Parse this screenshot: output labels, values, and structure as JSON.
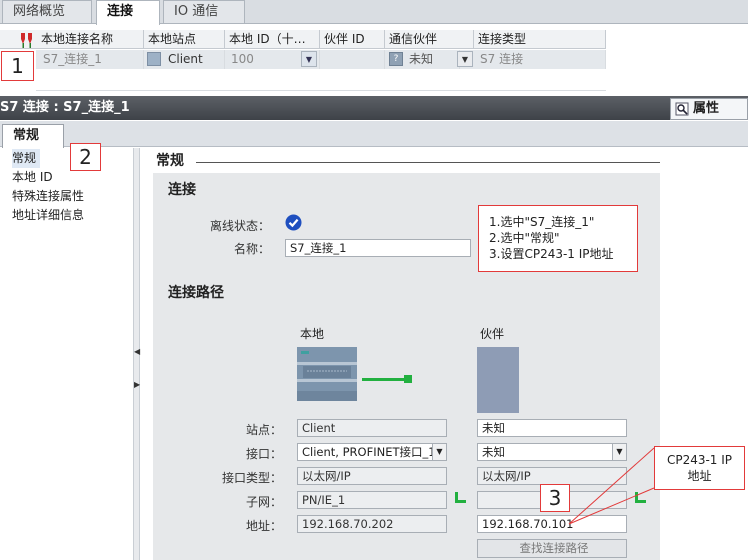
{
  "top_tabs": [
    "网络概览",
    "连接",
    "IO 通信"
  ],
  "table": {
    "headers": [
      "本地连接名称",
      "本地站点",
      "本地 ID（十…",
      "伙伴 ID",
      "通信伙伴",
      "连接类型"
    ],
    "row": {
      "name": "S7_连接_1",
      "station": "Client",
      "local_id": "100",
      "partner_id": "",
      "partner": "未知",
      "type": "S7 连接"
    }
  },
  "section_title": "S7 连接 : S7_连接_1",
  "properties_tab": "属性",
  "sub_tab": "常规",
  "nav_items": [
    "常规",
    "本地 ID",
    "特殊连接属性",
    "地址详细信息"
  ],
  "main": {
    "section_general": "常规",
    "group_connection": "连接",
    "offline_status_label": "离线状态：",
    "name_label": "名称：",
    "name_value": "S7_连接_1",
    "group_path": "连接路径",
    "local_header": "本地",
    "partner_header": "伙伴",
    "station_label": "站点：",
    "interface_label": "接口：",
    "interface_type_label": "接口类型：",
    "subnet_label": "子网：",
    "address_label": "地址：",
    "local": {
      "station": "Client",
      "interface": "Client, PROFINET接口_1",
      "interface_type": "以太网/IP",
      "subnet": "PN/IE_1",
      "address": "192.168.70.202"
    },
    "partner": {
      "station": "未知",
      "interface": "未知",
      "interface_type": "以太网/IP",
      "subnet": "",
      "address": "192.168.70.101"
    },
    "find_path_button": "查找连接路径"
  },
  "annotations": {
    "instructions": [
      "1.选中\"S7_连接_1\"",
      "2.选中\"常规\"",
      "3.设置CP243-1 IP地址"
    ],
    "callout": "CP243-1 IP\n地址",
    "step1": "1",
    "step2": "2",
    "step3": "3"
  },
  "colors": {
    "annotation_red": "#e23a3a",
    "header_dark": "#4a4e54",
    "status_blue": "#1f4fbf"
  }
}
